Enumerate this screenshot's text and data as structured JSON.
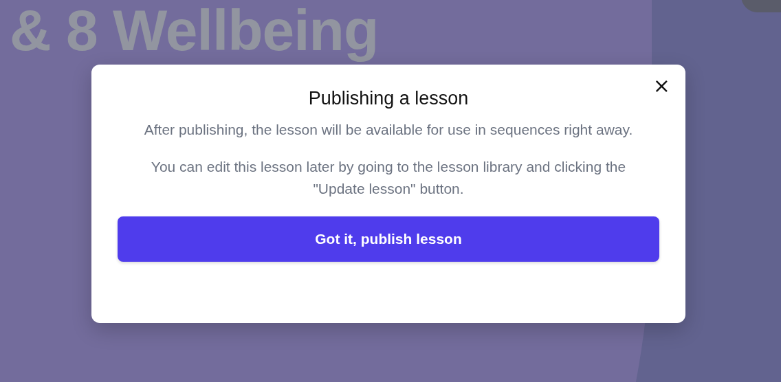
{
  "background": {
    "heading": "& 8 Wellbeing"
  },
  "dialog": {
    "title": "Publishing a lesson",
    "close": "×",
    "paragraphs": [
      "After publishing, the lesson will be available for use in sequences right away.",
      "You can edit this lesson later by going to the lesson library and clicking the \"Update lesson\" button."
    ],
    "button": "Got it, publish lesson"
  }
}
